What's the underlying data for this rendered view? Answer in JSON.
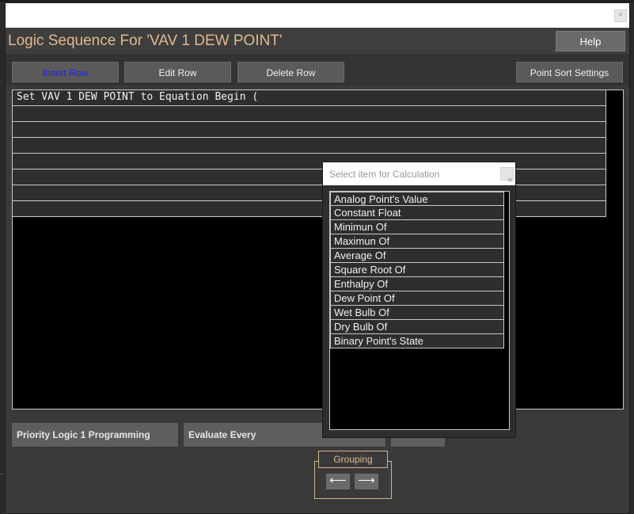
{
  "window": {
    "close_glyph": "×"
  },
  "header": {
    "title": "Logic Sequence For 'VAV 1 DEW POINT'",
    "help_label": "Help"
  },
  "toolbar": {
    "insert_row": "Insert Row",
    "edit_row": "Edit Row",
    "delete_row": "Delete Row",
    "point_sort": "Point Sort Settings"
  },
  "grid": {
    "rows": [
      "Set VAV 1 DEW POINT to Equation Begin (",
      "",
      "",
      "",
      "",
      "",
      "",
      ""
    ]
  },
  "bottom": {
    "priority_label": "Priority Logic 1 Programming",
    "evaluate_label": "Evaluate Every",
    "grouping_label": "Grouping",
    "left_arrow": "⟵",
    "right_arrow": "⟶"
  },
  "popup": {
    "title": "Select item for Calculation",
    "close_glyph": "×",
    "items": [
      "Analog Point's Value",
      "Constant Float",
      "Minimun Of",
      "Maximun Of",
      "Average Of",
      "Square Root Of",
      "Enthalpy Of",
      "Dew Point Of",
      "Wet Bulb Of",
      "Dry Bulb Of",
      "Binary Point's State"
    ]
  },
  "colors": {
    "title_accent": "#e0b98e",
    "active_link": "#1e1ef0"
  }
}
